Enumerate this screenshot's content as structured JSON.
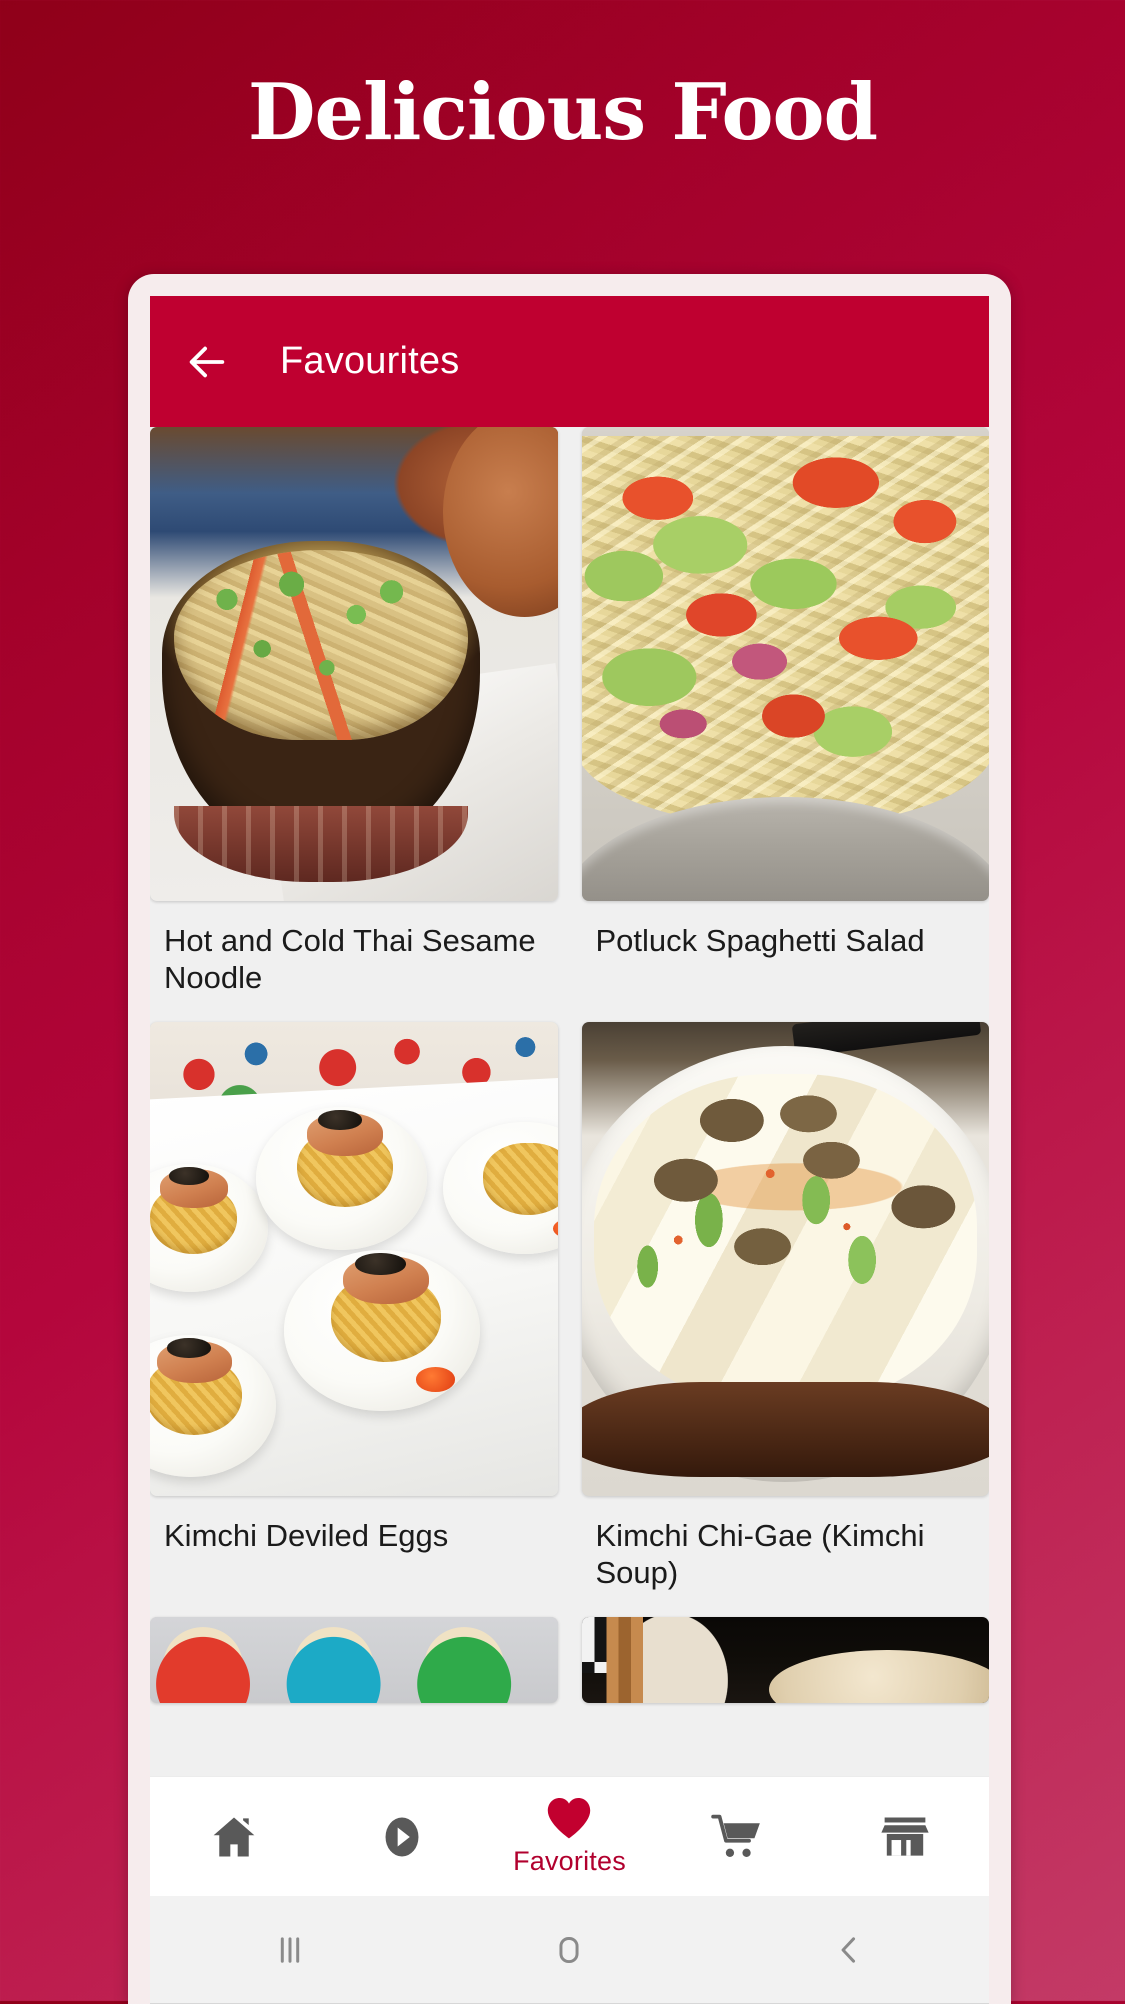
{
  "hero": {
    "title": "Delicious Food"
  },
  "app": {
    "app_bar": {
      "back_icon": "arrow-left-icon",
      "title": "Favourites"
    },
    "recipes": [
      {
        "title": "Hot  and Cold Thai Sesame Noodle",
        "image": "thai-sesame-noodle-bowl-photo"
      },
      {
        "title": "Potluck Spaghetti Salad",
        "image": "potluck-spaghetti-salad-photo"
      },
      {
        "title": "Kimchi Deviled Eggs",
        "image": "kimchi-deviled-eggs-photo"
      },
      {
        "title": "Kimchi Chi-Gae (Kimchi Soup)",
        "image": "kimchi-chi-gae-soup-photo"
      },
      {
        "title": "",
        "image": "rice-krispie-cups-photo"
      },
      {
        "title": "",
        "image": "bread-basket-photo"
      }
    ],
    "bottom_nav": [
      {
        "icon": "home-icon",
        "label": "",
        "active": false
      },
      {
        "icon": "play-circle-icon",
        "label": "",
        "active": false
      },
      {
        "icon": "heart-icon",
        "label": "Favorites",
        "active": true
      },
      {
        "icon": "cart-icon",
        "label": "",
        "active": false
      },
      {
        "icon": "store-icon",
        "label": "",
        "active": false
      }
    ],
    "system_nav": [
      {
        "icon": "recents-icon"
      },
      {
        "icon": "home-square-icon"
      },
      {
        "icon": "back-chevron-icon"
      }
    ]
  },
  "colors": {
    "background_start": "#8f0019",
    "background_end": "#c33a66",
    "app_bar": "#bf0030",
    "accent_heart": "#c2002f",
    "favorites_label": "#b1002e",
    "frame": "#f6eced",
    "screen_bg": "#f0f0f0",
    "nav_icon_grey": "#595959"
  }
}
